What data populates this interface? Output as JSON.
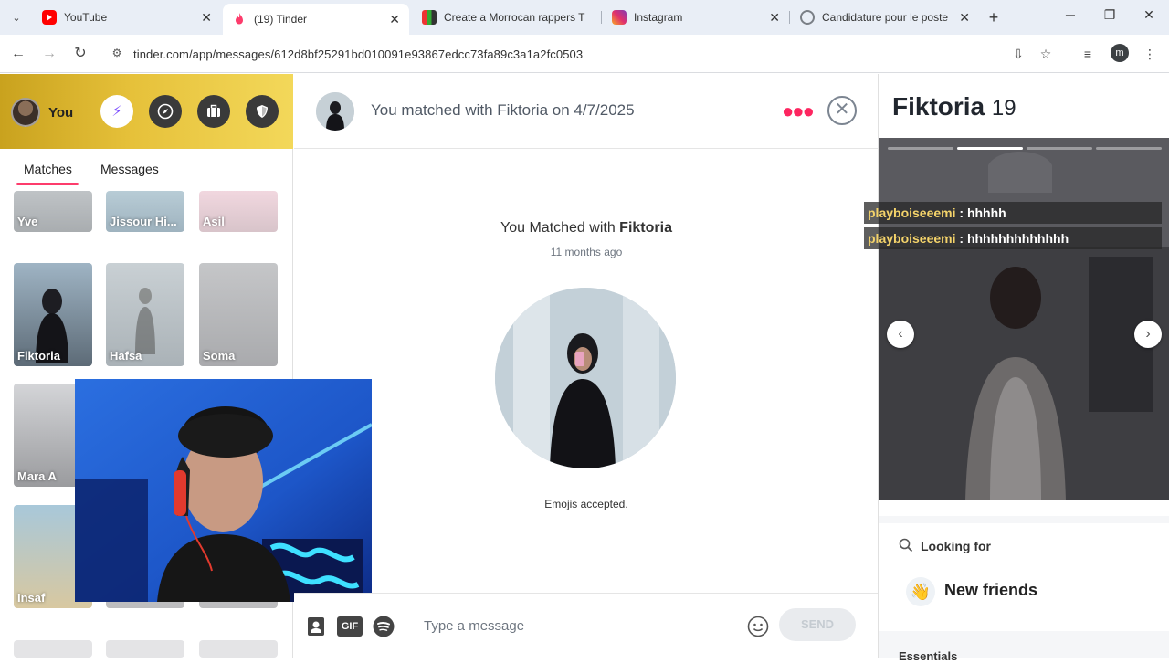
{
  "browser": {
    "tabs": [
      {
        "title": "YouTube",
        "active": false,
        "color": "#ff0000"
      },
      {
        "title": "(19) Tinder",
        "active": true,
        "color": "#fd3c6c"
      },
      {
        "title": "Create a Morrocan rappers T",
        "active": false,
        "color": "#4a4a4a"
      },
      {
        "title": "Instagram",
        "active": false,
        "color": "#e1306c"
      },
      {
        "title": "Candidature pour le poste",
        "active": false,
        "color": "#7a7f86"
      }
    ],
    "url": "tinder.com/app/messages/612d8bf25291bd010091e93867edcc73fa89c3a1a2fc0503",
    "profile_initial": "m"
  },
  "sidebar": {
    "user_label": "You",
    "tabs": [
      "Matches",
      "Messages"
    ],
    "matches": [
      {
        "name": "Yve"
      },
      {
        "name": "Jissour Hi..."
      },
      {
        "name": "Asil"
      },
      {
        "name": "Fiktoria"
      },
      {
        "name": "Hafsa"
      },
      {
        "name": "Soma"
      },
      {
        "name": "Mara A"
      },
      {
        "name": "Insaf"
      }
    ]
  },
  "chat": {
    "header_title": "You matched with Fiktoria on 4/7/2025",
    "match_prefix": "You Matched with ",
    "match_name": "Fiktoria",
    "match_ago": "11 months ago",
    "emojis_note": "Emojis accepted.",
    "composer": {
      "gif_label": "GIF",
      "placeholder": "Type a message",
      "send_label": "SEND"
    }
  },
  "profile": {
    "name": "Fiktoria",
    "age": "19",
    "photo_count": 4,
    "photo_index": 2,
    "looking_for_label": "Looking for",
    "looking_for_value": "New friends",
    "essentials_label": "Essentials"
  },
  "live_comments": [
    {
      "user": "playboiseeemi",
      "text": " : hhhhh"
    },
    {
      "user": "playboiseeemi",
      "text": " : hhhhhhhhhhhhh"
    }
  ],
  "colors": {
    "tinder_pink": "#fd3c6c",
    "sidebar_gold": "#e6c13a"
  }
}
